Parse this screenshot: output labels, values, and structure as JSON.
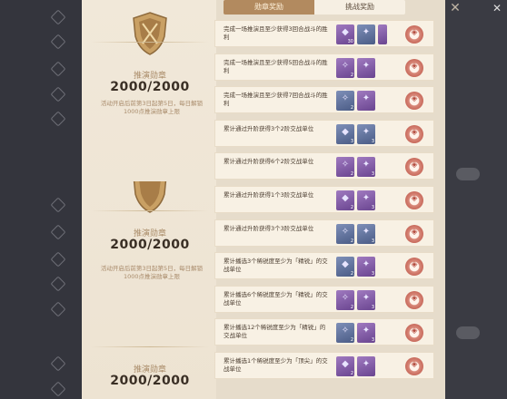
{
  "background": {
    "left_items": [
      "",
      "",
      "",
      "",
      "",
      "",
      "",
      "",
      "",
      "",
      "",
      ""
    ],
    "right_texts": [
      "",
      "",
      ""
    ]
  },
  "tabs": [
    {
      "label": "勋章奖励",
      "active": true
    },
    {
      "label": "挑战奖励",
      "active": false
    }
  ],
  "emblems": [
    {
      "label": "推演勋章",
      "value": "2000/2000",
      "desc": "活动开启后前第3日起第5日，每日解锁1000点推演勋章上限"
    },
    {
      "label": "推演勋章",
      "value": "2000/2000",
      "desc": "活动开启后前第3日起第5日，每日解锁1000点推演勋章上限"
    },
    {
      "label": "推演勋章",
      "value": "2000/2000",
      "desc": ""
    }
  ],
  "quests": [
    {
      "text": "完成一场推演且至少获得3回合战斗的胜利",
      "rewards": [
        {
          "color": "purple",
          "glyph": "◆",
          "qty": "30"
        },
        {
          "color": "blue",
          "glyph": "✦",
          "qty": ""
        },
        {
          "color": "purple",
          "glyph": "",
          "qty": "",
          "half": true
        }
      ]
    },
    {
      "text": "完成一场推演且至少获得5回合战斗的胜利",
      "rewards": [
        {
          "color": "purple",
          "glyph": "✧",
          "qty": "2"
        },
        {
          "color": "purple",
          "glyph": "✦",
          "qty": ""
        }
      ]
    },
    {
      "text": "完成一场推演且至少获得7回合战斗的胜利",
      "rewards": [
        {
          "color": "blue",
          "glyph": "✧",
          "qty": "2"
        },
        {
          "color": "purple",
          "glyph": "✦",
          "qty": ""
        }
      ]
    },
    {
      "text": "累计通过升阶获得3个2阶交战单位",
      "rewards": [
        {
          "color": "blue",
          "glyph": "◆",
          "qty": "3"
        },
        {
          "color": "blue",
          "glyph": "✦",
          "qty": "3"
        }
      ]
    },
    {
      "text": "累计通过升阶获得6个2阶交战单位",
      "rewards": [
        {
          "color": "purple",
          "glyph": "✧",
          "qty": "2"
        },
        {
          "color": "purple",
          "glyph": "✦",
          "qty": "3"
        }
      ]
    },
    {
      "text": "累计通过升阶获得1个3阶交战单位",
      "rewards": [
        {
          "color": "purple",
          "glyph": "◆",
          "qty": "2"
        },
        {
          "color": "purple",
          "glyph": "✦",
          "qty": "3"
        }
      ]
    },
    {
      "text": "累计通过升阶获得3个3阶交战单位",
      "rewards": [
        {
          "color": "blue",
          "glyph": "✧",
          "qty": "2"
        },
        {
          "color": "blue",
          "glyph": "✦",
          "qty": "3"
        }
      ]
    },
    {
      "text": "累计播选3个稀锐度至少为「精锐」的交战单位",
      "rewards": [
        {
          "color": "blue",
          "glyph": "◆",
          "qty": "2"
        },
        {
          "color": "purple",
          "glyph": "✦",
          "qty": "3"
        }
      ]
    },
    {
      "text": "累计播选6个稀锐度至少为「精锐」的交战单位",
      "rewards": [
        {
          "color": "purple",
          "glyph": "✧",
          "qty": "2"
        },
        {
          "color": "purple",
          "glyph": "✦",
          "qty": "3"
        }
      ]
    },
    {
      "text": "累计播选12个稀锐度至少为「精锐」的交战单位",
      "rewards": [
        {
          "color": "blue",
          "glyph": "✧",
          "qty": "2"
        },
        {
          "color": "purple",
          "glyph": "✦",
          "qty": "3"
        }
      ]
    },
    {
      "text": "累计播选1个稀锐度至少为「顶尖」的交战单位",
      "rewards": [
        {
          "color": "purple",
          "glyph": "◆",
          "qty": "2"
        },
        {
          "color": "purple",
          "glyph": "✦",
          "qty": ""
        }
      ]
    }
  ],
  "colors": {
    "panel": "#efe6d6",
    "tab_active": "#b28a5f",
    "claim": "#c86a5c"
  }
}
